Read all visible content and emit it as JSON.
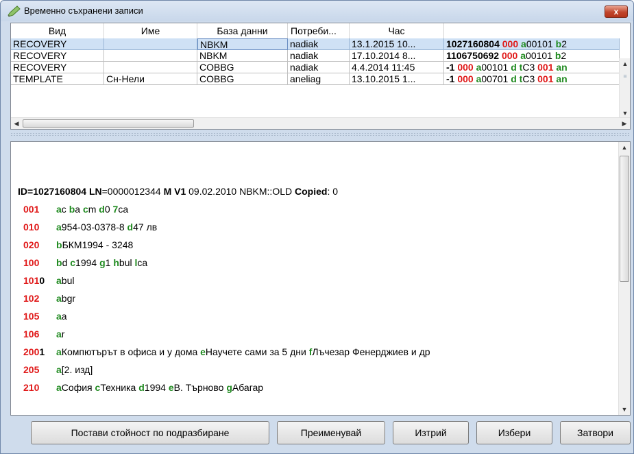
{
  "window": {
    "title": "Временно съхранени записи",
    "close_label": "x"
  },
  "grid": {
    "columns": [
      "Вид",
      "Име",
      "База данни",
      "Потреби...",
      "Час"
    ],
    "rows": [
      {
        "kind": "RECOVERY",
        "name": "",
        "db": "NBKM",
        "user": "nadiak",
        "time": "13.1.2015 10...",
        "record": [
          [
            "b",
            "1027160804 "
          ],
          [
            "r",
            "000 "
          ],
          [
            "g",
            "a"
          ],
          [
            "n",
            "00101 "
          ],
          [
            "g",
            "b"
          ],
          [
            "n",
            "2"
          ]
        ]
      },
      {
        "kind": "RECOVERY",
        "name": "",
        "db": "NBKM",
        "user": "nadiak",
        "time": "17.10.2014 8...",
        "record": [
          [
            "b",
            "1106750692 "
          ],
          [
            "r",
            "000 "
          ],
          [
            "g",
            "a"
          ],
          [
            "n",
            "00101 "
          ],
          [
            "g",
            "b"
          ],
          [
            "n",
            "2"
          ]
        ]
      },
      {
        "kind": "RECOVERY",
        "name": "",
        "db": "COBBG",
        "user": "nadiak",
        "time": "4.4.2014 11:45",
        "record": [
          [
            "b",
            "-1 "
          ],
          [
            "r",
            "000 "
          ],
          [
            "g",
            "a"
          ],
          [
            "n",
            "00101 "
          ],
          [
            "g",
            "d "
          ],
          [
            "g",
            "t"
          ],
          [
            "n",
            "C3 "
          ],
          [
            "r",
            "001 "
          ],
          [
            "g",
            "an"
          ]
        ]
      },
      {
        "kind": "TEMPLATE",
        "name": "Сн-Нели",
        "db": "COBBG",
        "user": "aneliag",
        "time": "13.10.2015 1...",
        "record": [
          [
            "b",
            "-1 "
          ],
          [
            "r",
            "000 "
          ],
          [
            "g",
            "a"
          ],
          [
            "n",
            "00701 "
          ],
          [
            "g",
            "d "
          ],
          [
            "g",
            "t"
          ],
          [
            "n",
            "C3 "
          ],
          [
            "r",
            "001 "
          ],
          [
            "g",
            "an"
          ]
        ]
      }
    ]
  },
  "record": {
    "header": [
      [
        "b",
        "ID="
      ],
      [
        "b",
        "1027160804 "
      ],
      [
        "b",
        "LN"
      ],
      [
        "n",
        "=0000012344 "
      ],
      [
        "b",
        "M V1 "
      ],
      [
        "n",
        "09.02.2010 NBKM::OLD "
      ],
      [
        "b",
        "Copied"
      ],
      [
        "n",
        ": 0"
      ]
    ],
    "fields": [
      {
        "tag": "001",
        "tag_tail": "",
        "parts": [
          [
            "g",
            "a"
          ],
          [
            "n",
            "c "
          ],
          [
            "g",
            "b"
          ],
          [
            "n",
            "a "
          ],
          [
            "g",
            "c"
          ],
          [
            "n",
            "m "
          ],
          [
            "g",
            "d"
          ],
          [
            "n",
            "0 "
          ],
          [
            "g",
            "7"
          ],
          [
            "n",
            "ca"
          ]
        ]
      },
      {
        "tag": "010",
        "tag_tail": "",
        "parts": [
          [
            "g",
            "a"
          ],
          [
            "n",
            "954-03-0378-8 "
          ],
          [
            "g",
            "d"
          ],
          [
            "n",
            "47 лв"
          ]
        ]
      },
      {
        "tag": "020",
        "tag_tail": "",
        "parts": [
          [
            "g",
            "b"
          ],
          [
            "n",
            "БКМ1994 - 3248"
          ]
        ]
      },
      {
        "tag": "100",
        "tag_tail": "",
        "parts": [
          [
            "g",
            "b"
          ],
          [
            "n",
            "d "
          ],
          [
            "g",
            "c"
          ],
          [
            "n",
            "1994 "
          ],
          [
            "g",
            "g"
          ],
          [
            "n",
            "1 "
          ],
          [
            "g",
            "h"
          ],
          [
            "n",
            "bul "
          ],
          [
            "g",
            "l"
          ],
          [
            "n",
            "ca"
          ]
        ]
      },
      {
        "tag": "101",
        "tag_tail": "0",
        "parts": [
          [
            "g",
            "a"
          ],
          [
            "n",
            "bul"
          ]
        ]
      },
      {
        "tag": "102",
        "tag_tail": "",
        "parts": [
          [
            "g",
            "a"
          ],
          [
            "n",
            "bgr"
          ]
        ]
      },
      {
        "tag": "105",
        "tag_tail": "",
        "parts": [
          [
            "g",
            "a"
          ],
          [
            "n",
            "a"
          ]
        ]
      },
      {
        "tag": "106",
        "tag_tail": "",
        "parts": [
          [
            "g",
            "a"
          ],
          [
            "n",
            "r"
          ]
        ]
      },
      {
        "tag": "200",
        "tag_tail": "1",
        "parts": [
          [
            "g",
            "a"
          ],
          [
            "n",
            "Компютърът в офиса и у дома "
          ],
          [
            "g",
            "e"
          ],
          [
            "n",
            "Научете сами за 5 дни "
          ],
          [
            "g",
            "f"
          ],
          [
            "n",
            "Лъчезар Фенерджиев и др"
          ]
        ]
      },
      {
        "tag": "205",
        "tag_tail": "",
        "parts": [
          [
            "g",
            "a"
          ],
          [
            "n",
            "[2. изд]"
          ]
        ]
      },
      {
        "tag": "210",
        "tag_tail": "",
        "parts": [
          [
            "g",
            "a"
          ],
          [
            "n",
            "София "
          ],
          [
            "g",
            "c"
          ],
          [
            "n",
            "Техника "
          ],
          [
            "g",
            "d"
          ],
          [
            "n",
            "1994 "
          ],
          [
            "g",
            "e"
          ],
          [
            "n",
            "В. Търново "
          ],
          [
            "g",
            "g"
          ],
          [
            "n",
            "Абагар"
          ]
        ]
      }
    ]
  },
  "buttons": {
    "default": "Постави стойност по подразбиране",
    "rename": "Преименувай",
    "delete": "Изтрий",
    "select": "Избери",
    "close": "Затвори"
  },
  "icons": {
    "title": "pencil-icon",
    "close": "close-icon"
  },
  "colors": {
    "tag": "#e01818",
    "subfield": "#1f8a1f",
    "selection": "#cfe1f5"
  }
}
